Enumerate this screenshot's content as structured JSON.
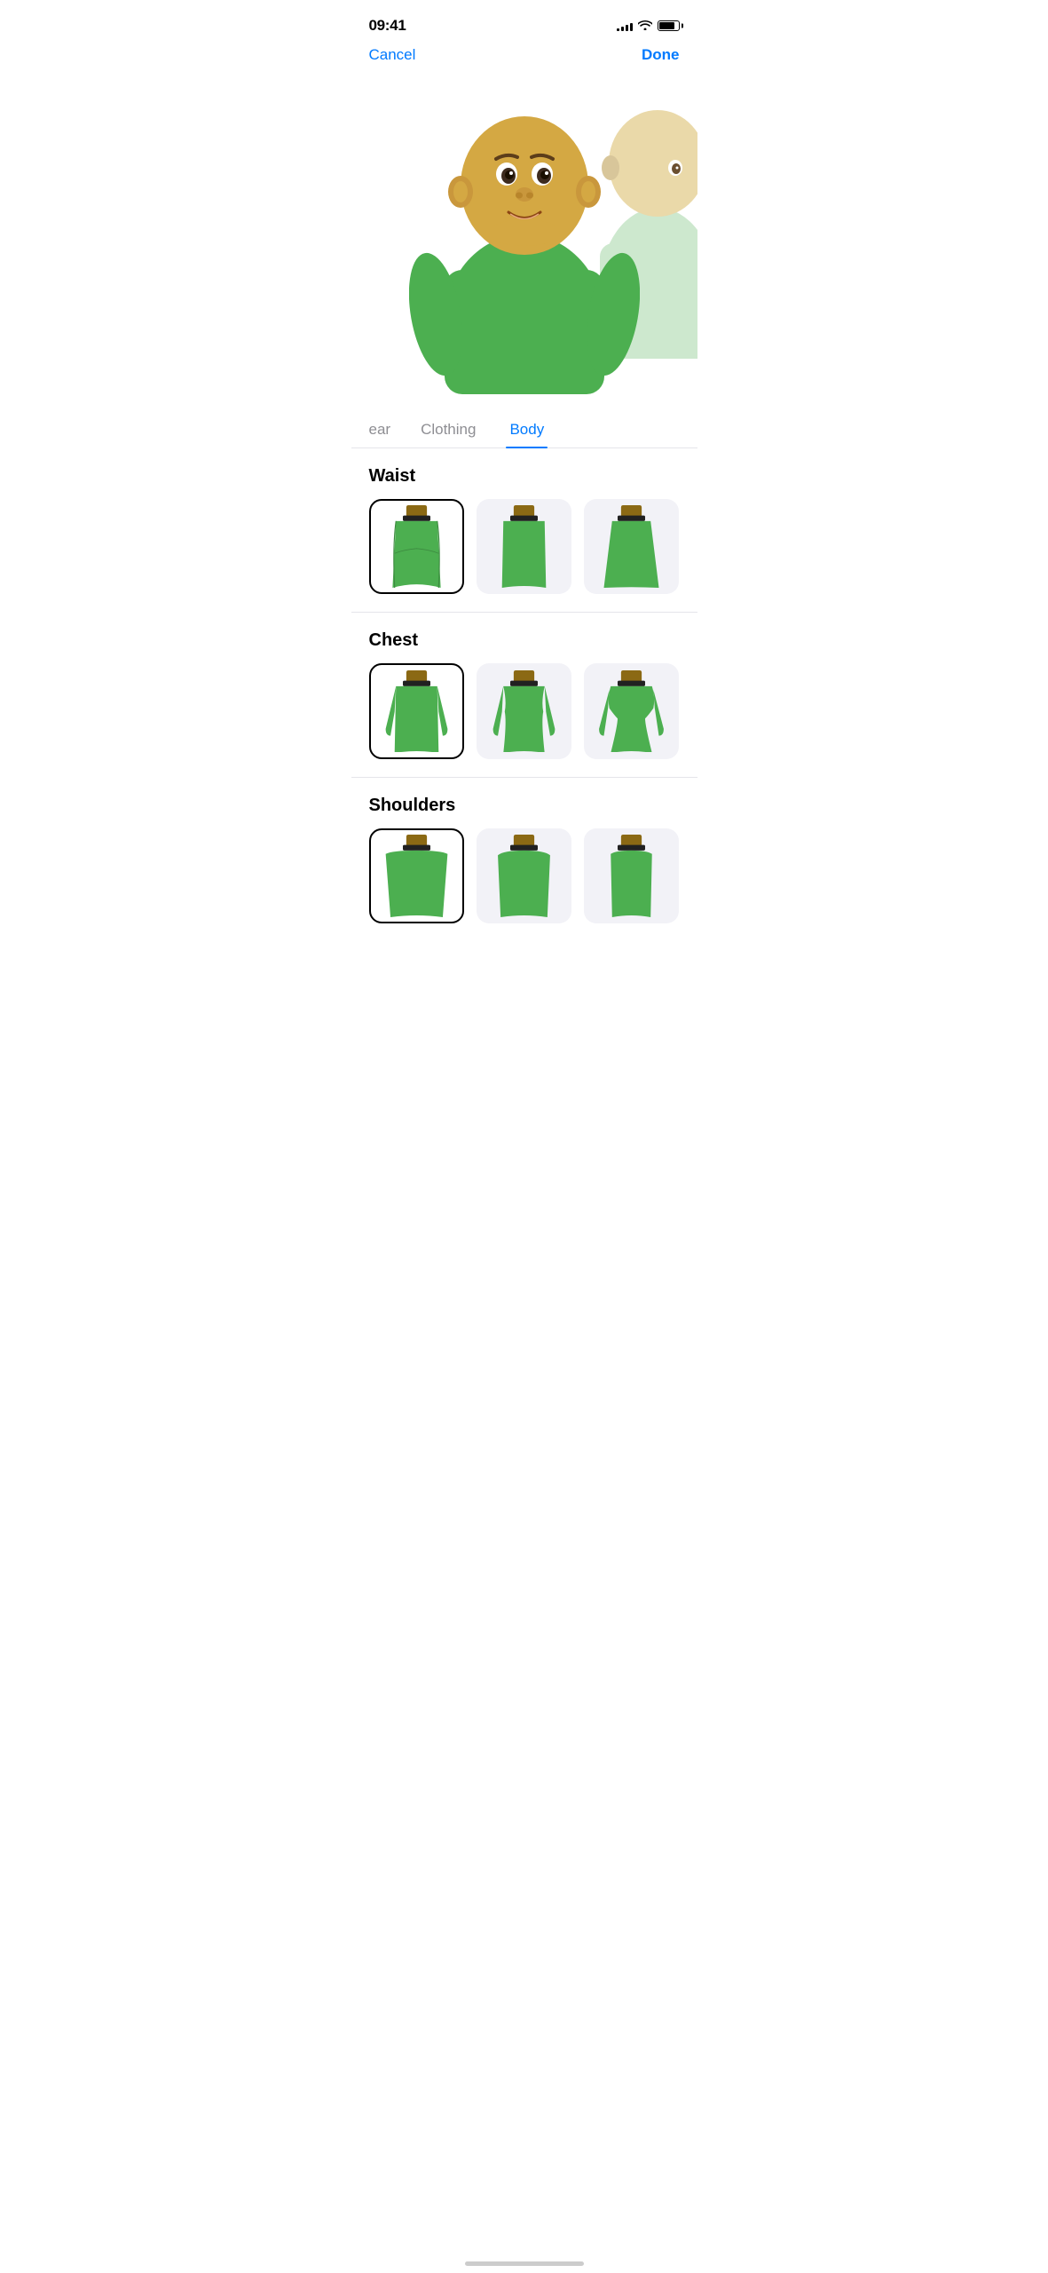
{
  "statusBar": {
    "time": "09:41",
    "signalBars": [
      3,
      5,
      7,
      9,
      11
    ],
    "battery": 85
  },
  "nav": {
    "cancel": "Cancel",
    "done": "Done"
  },
  "tabs": {
    "items": [
      {
        "id": "headwear",
        "label": "ear",
        "active": false,
        "partial": true
      },
      {
        "id": "clothing",
        "label": "Clothing",
        "active": false
      },
      {
        "id": "body",
        "label": "Body",
        "active": true
      }
    ]
  },
  "sections": [
    {
      "id": "waist",
      "title": "Waist",
      "options": [
        {
          "id": "waist-1",
          "selected": true
        },
        {
          "id": "waist-2",
          "selected": false
        },
        {
          "id": "waist-3",
          "selected": false
        }
      ]
    },
    {
      "id": "chest",
      "title": "Chest",
      "options": [
        {
          "id": "chest-1",
          "selected": true
        },
        {
          "id": "chest-2",
          "selected": false
        },
        {
          "id": "chest-3",
          "selected": false
        }
      ]
    },
    {
      "id": "shoulders",
      "title": "Shoulders",
      "options": [
        {
          "id": "shoulders-1",
          "selected": true
        },
        {
          "id": "shoulders-2",
          "selected": false
        },
        {
          "id": "shoulders-3",
          "selected": false
        }
      ]
    }
  ],
  "homeIndicator": {
    "visible": true
  }
}
